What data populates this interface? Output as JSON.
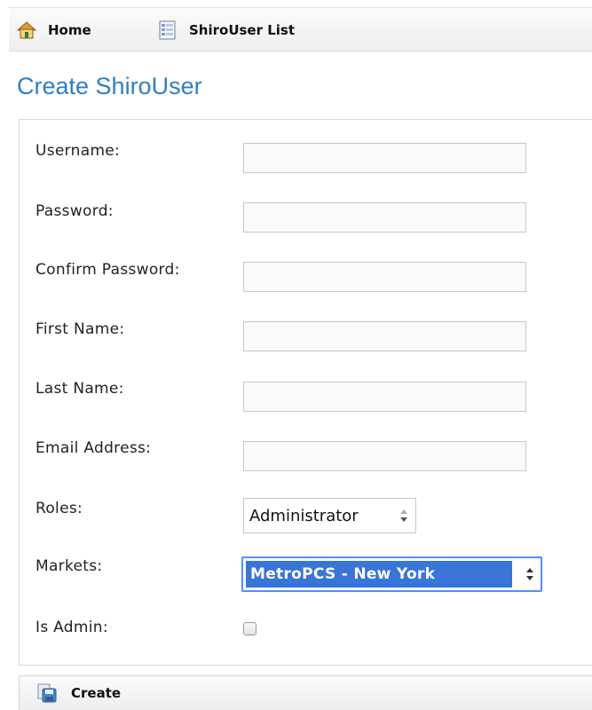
{
  "nav": {
    "home_label": "Home",
    "list_label": "ShiroUser List"
  },
  "page": {
    "title": "Create ShiroUser"
  },
  "form": {
    "username_label": "Username:",
    "password_label": "Password:",
    "confirm_password_label": "Confirm Password:",
    "first_name_label": "First Name:",
    "last_name_label": "Last Name:",
    "email_label": "Email Address:",
    "roles_label": "Roles:",
    "roles_value": "Administrator",
    "markets_label": "Markets:",
    "markets_value": "MetroPCS - New York",
    "is_admin_label": "Is Admin:",
    "is_admin_checked": false
  },
  "actions": {
    "create_label": "Create"
  },
  "icons": {
    "home": "home-icon",
    "list": "list-icon",
    "create": "create-icon",
    "spinner": "select-arrows-icon"
  },
  "colors": {
    "title": "#2f7fc0",
    "selection_bg": "#3875d7",
    "focus_border": "#4d90fe"
  }
}
